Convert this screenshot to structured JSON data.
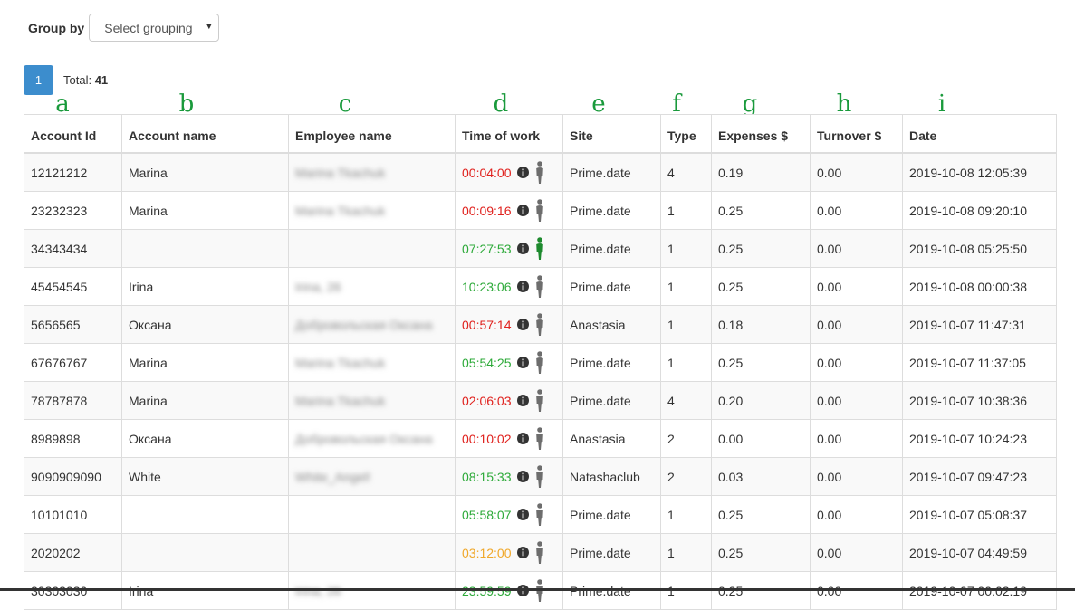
{
  "toolbar": {
    "group_by_label": "Group by",
    "select_value": "Select grouping"
  },
  "pager": {
    "page": "1",
    "total_label": "Total:",
    "total_value": "41"
  },
  "letters": [
    "a",
    "b",
    "c",
    "d",
    "e",
    "f",
    "g",
    "h",
    "i"
  ],
  "table": {
    "headers": [
      "Account Id",
      "Account name",
      "Employee name",
      "Time of work",
      "Site",
      "Type",
      "Expenses $",
      "Turnover $",
      "Date"
    ],
    "rows": [
      {
        "id": "12121212",
        "account": "Marina",
        "employee": "Marina Tkachuk",
        "time": "00:04:00",
        "status": "red",
        "icon": "gray",
        "site": "Prime.date",
        "type": "4",
        "expenses": "0.19",
        "turnover": "0.00",
        "date": "2019-10-08 12:05:39"
      },
      {
        "id": "23232323",
        "account": "Marina",
        "employee": "Marina Tkachuk",
        "time": "00:09:16",
        "status": "red",
        "icon": "gray",
        "site": "Prime.date",
        "type": "1",
        "expenses": "0.25",
        "turnover": "0.00",
        "date": "2019-10-08 09:20:10"
      },
      {
        "id": "34343434",
        "account": "",
        "employee": "",
        "time": "07:27:53",
        "status": "green",
        "icon": "green",
        "site": "Prime.date",
        "type": "1",
        "expenses": "0.25",
        "turnover": "0.00",
        "date": "2019-10-08 05:25:50"
      },
      {
        "id": "45454545",
        "account": "Irina",
        "employee": "Irina, 26",
        "time": "10:23:06",
        "status": "green",
        "icon": "gray",
        "site": "Prime.date",
        "type": "1",
        "expenses": "0.25",
        "turnover": "0.00",
        "date": "2019-10-08 00:00:38"
      },
      {
        "id": "5656565",
        "account": "Оксана",
        "employee": "Добровольская Оксана",
        "time": "00:57:14",
        "status": "red",
        "icon": "gray",
        "site": "Anastasia",
        "type": "1",
        "expenses": "0.18",
        "turnover": "0.00",
        "date": "2019-10-07 11:47:31"
      },
      {
        "id": "67676767",
        "account": "Marina",
        "employee": "Marina Tkachuk",
        "time": "05:54:25",
        "status": "green",
        "icon": "gray",
        "site": "Prime.date",
        "type": "1",
        "expenses": "0.25",
        "turnover": "0.00",
        "date": "2019-10-07 11:37:05"
      },
      {
        "id": "78787878",
        "account": "Marina",
        "employee": "Marina Tkachuk",
        "time": "02:06:03",
        "status": "red",
        "icon": "gray",
        "site": "Prime.date",
        "type": "4",
        "expenses": "0.20",
        "turnover": "0.00",
        "date": "2019-10-07 10:38:36"
      },
      {
        "id": "8989898",
        "account": "Оксана",
        "employee": "Добровольская Оксана",
        "time": "00:10:02",
        "status": "red",
        "icon": "gray",
        "site": "Anastasia",
        "type": "2",
        "expenses": "0.00",
        "turnover": "0.00",
        "date": "2019-10-07 10:24:23"
      },
      {
        "id": "9090909090",
        "account": "White",
        "employee": "White_Angel!",
        "time": "08:15:33",
        "status": "green",
        "icon": "gray",
        "site": "Natashaclub",
        "type": "2",
        "expenses": "0.03",
        "turnover": "0.00",
        "date": "2019-10-07 09:47:23"
      },
      {
        "id": "10101010",
        "account": "",
        "employee": "",
        "time": "05:58:07",
        "status": "green",
        "icon": "gray",
        "site": "Prime.date",
        "type": "1",
        "expenses": "0.25",
        "turnover": "0.00",
        "date": "2019-10-07 05:08:37"
      },
      {
        "id": "2020202",
        "account": "",
        "employee": "",
        "time": "03:12:00",
        "status": "orange",
        "icon": "gray",
        "site": "Prime.date",
        "type": "1",
        "expenses": "0.25",
        "turnover": "0.00",
        "date": "2019-10-07 04:49:59"
      },
      {
        "id": "30303030",
        "account": "Irina",
        "employee": "Irina, 26",
        "time": "23:59:59",
        "status": "green",
        "icon": "gray",
        "site": "Prime.date",
        "type": "1",
        "expenses": "0.25",
        "turnover": "0.00",
        "date": "2019-10-07 00:02:19"
      }
    ]
  },
  "colors": {
    "accent": "#3c8dcd",
    "letter": "#1a9a3c",
    "red": "#e0221e",
    "green": "#2eaa3a",
    "orange": "#f0a82a",
    "icon_gray": "#6d6d6d",
    "icon_green": "#1e8a2e"
  }
}
